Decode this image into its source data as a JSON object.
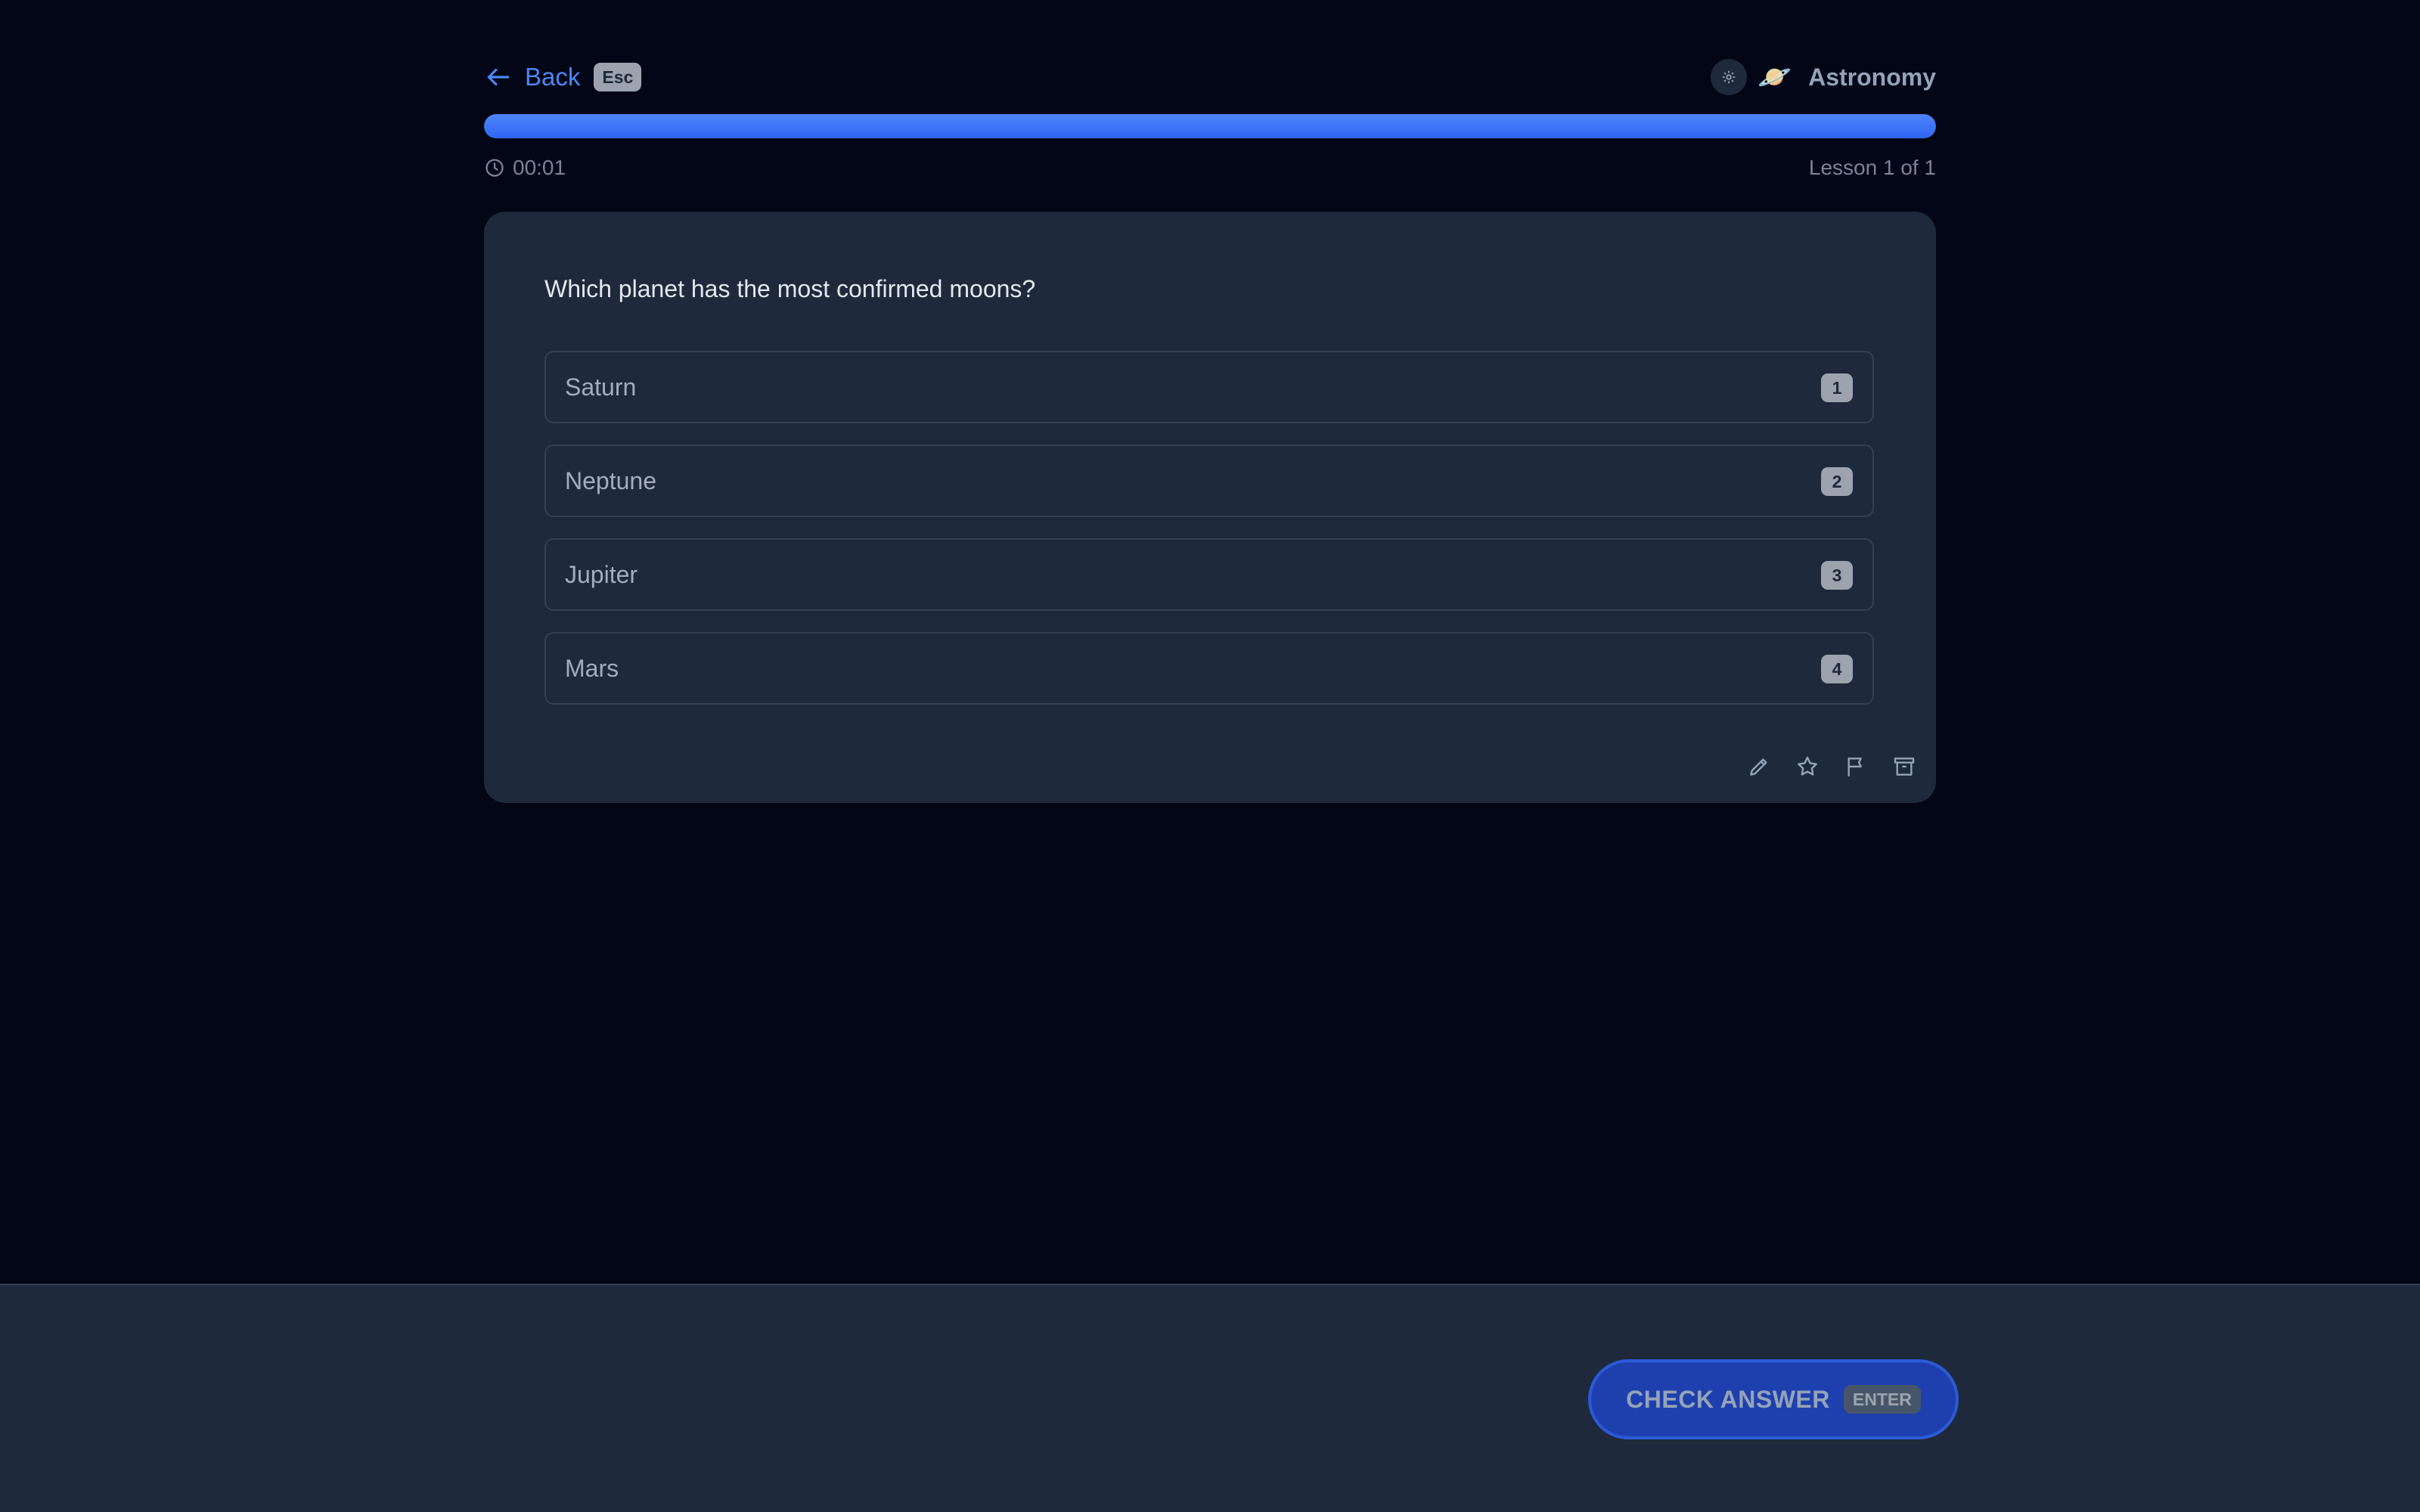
{
  "header": {
    "back_label": "Back",
    "back_shortcut": "Esc",
    "subject_emoji": "🪐",
    "subject_name": "Astronomy"
  },
  "progress": {
    "fraction": 1.0
  },
  "meta": {
    "timer": "00:01",
    "lesson": "Lesson 1 of 1"
  },
  "question": {
    "text": "Which planet has the most confirmed moons?",
    "options": [
      {
        "label": "Saturn",
        "key": "1"
      },
      {
        "label": "Neptune",
        "key": "2"
      },
      {
        "label": "Jupiter",
        "key": "3"
      },
      {
        "label": "Mars",
        "key": "4"
      }
    ]
  },
  "card_actions": [
    "pencil-icon",
    "star-icon",
    "flag-icon",
    "archive-icon"
  ],
  "footer": {
    "check_label": "CHECK ANSWER",
    "check_shortcut": "ENTER"
  },
  "colors": {
    "background": "#020617",
    "card": "#1e293b",
    "accent": "#4d86f5",
    "progress": "#3b74f7"
  }
}
